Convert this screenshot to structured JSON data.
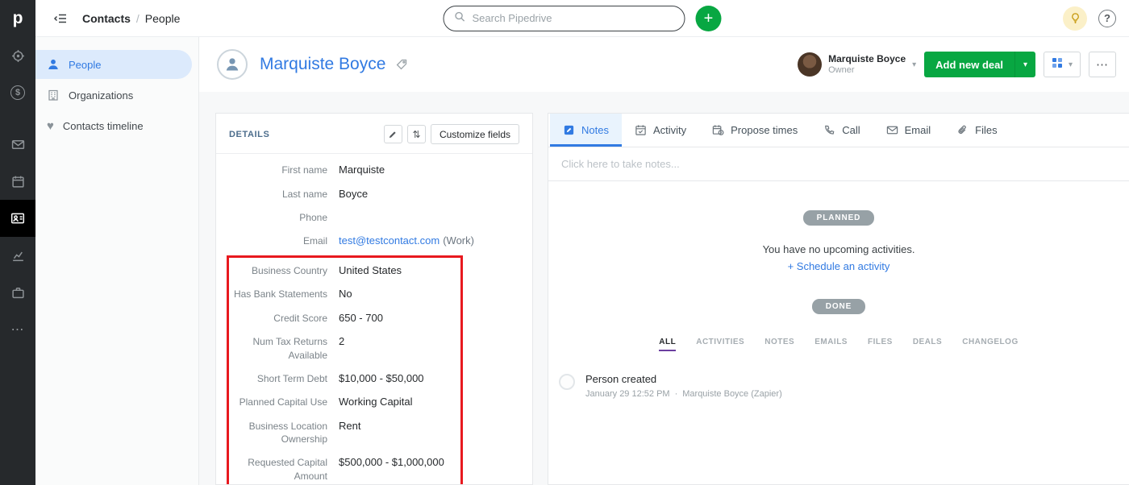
{
  "glyphs": {
    "logo": "p",
    "dollar": "$",
    "question": "?",
    "plus": "+",
    "chevron_down": "▾",
    "ellipsis": "⋯",
    "sort": "⇅",
    "heart": "♥"
  },
  "topbar": {
    "breadcrumb": {
      "section": "Contacts",
      "separator": "/",
      "page": "People"
    },
    "search_placeholder": "Search Pipedrive"
  },
  "subnav": {
    "items": [
      {
        "label": "People"
      },
      {
        "label": "Organizations"
      },
      {
        "label": "Contacts timeline"
      }
    ]
  },
  "page_header": {
    "name": "Marquiste Boyce",
    "owner_name": "Marquiste Boyce",
    "owner_role": "Owner",
    "add_deal": "Add new deal"
  },
  "details": {
    "title": "DETAILS",
    "customize_button": "Customize fields",
    "fields_top": [
      {
        "label": "First name",
        "value": "Marquiste"
      },
      {
        "label": "Last name",
        "value": "Boyce"
      },
      {
        "label": "Phone",
        "value": ""
      }
    ],
    "email": {
      "label": "Email",
      "value": "test@testcontact.com",
      "suffix": "(Work)"
    },
    "fields_highlighted": [
      {
        "label": "Business Country",
        "value": "United States"
      },
      {
        "label": "Has Bank Statements",
        "value": "No"
      },
      {
        "label": "Credit Score",
        "value": "650 - 700"
      },
      {
        "label": "Num Tax Returns Available",
        "value": "2"
      },
      {
        "label": "Short Term Debt",
        "value": "$10,000 - $50,000"
      },
      {
        "label": "Planned Capital Use",
        "value": "Working Capital"
      },
      {
        "label": "Business Location Ownership",
        "value": "Rent"
      },
      {
        "label": "Requested Capital Amount",
        "value": "$500,000 - $1,000,000"
      }
    ]
  },
  "tabs": [
    {
      "label": "Notes"
    },
    {
      "label": "Activity"
    },
    {
      "label": "Propose times"
    },
    {
      "label": "Call"
    },
    {
      "label": "Email"
    },
    {
      "label": "Files"
    }
  ],
  "notes": {
    "placeholder": "Click here to take notes..."
  },
  "activities": {
    "planned_badge": "PLANNED",
    "empty_text": "You have no upcoming activities.",
    "schedule_link": "+ Schedule an activity",
    "done_badge": "DONE"
  },
  "history": {
    "filters": [
      {
        "label": "ALL"
      },
      {
        "label": "ACTIVITIES"
      },
      {
        "label": "NOTES"
      },
      {
        "label": "EMAILS"
      },
      {
        "label": "FILES"
      },
      {
        "label": "DEALS"
      },
      {
        "label": "CHANGELOG"
      }
    ],
    "items": [
      {
        "title": "Person created",
        "timestamp": "January 29 12:52 PM",
        "separator": "·",
        "by": "Marquiste Boyce (Zapier)"
      }
    ]
  },
  "colors": {
    "green": "#08a742",
    "blue": "#317ae2",
    "red_annotation": "#e8191f"
  }
}
